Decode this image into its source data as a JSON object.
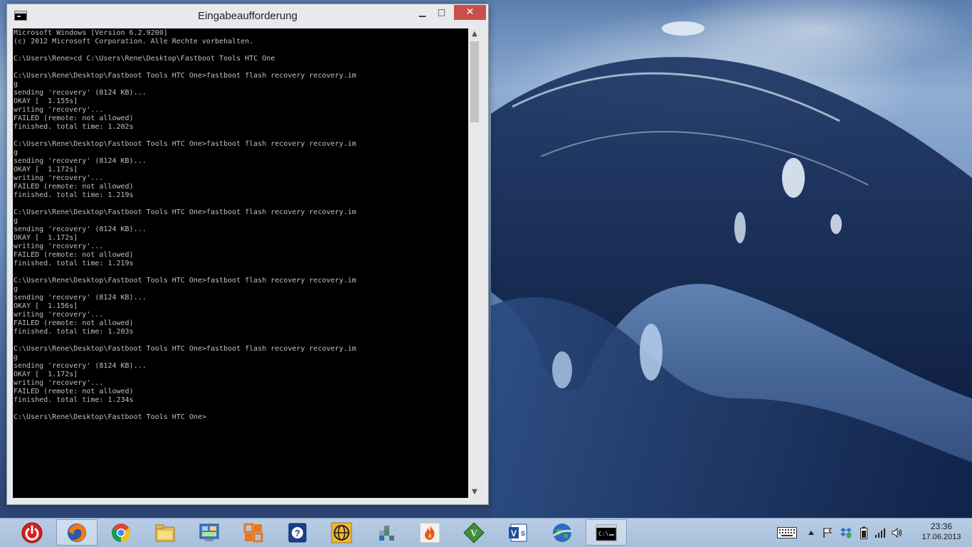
{
  "window": {
    "title": "Eingabeaufforderung",
    "minimize_glyph": "▁",
    "maximize_glyph": "□",
    "close_glyph": "✕",
    "console_lines": [
      "Microsoft Windows [Version 6.2.9200]",
      "(c) 2012 Microsoft Corporation. Alle Rechte vorbehalten.",
      "",
      "C:\\Users\\Rene>cd C:\\Users\\Rene\\Desktop\\Fastboot Tools HTC One",
      "",
      "C:\\Users\\Rene\\Desktop\\Fastboot Tools HTC One>fastboot flash recovery recovery.im",
      "g",
      "sending 'recovery' (8124 KB)...",
      "OKAY [  1.155s]",
      "writing 'recovery'...",
      "FAILED (remote: not allowed)",
      "finished. total time: 1.202s",
      "",
      "C:\\Users\\Rene\\Desktop\\Fastboot Tools HTC One>fastboot flash recovery recovery.im",
      "g",
      "sending 'recovery' (8124 KB)...",
      "OKAY [  1.172s]",
      "writing 'recovery'...",
      "FAILED (remote: not allowed)",
      "finished. total time: 1.219s",
      "",
      "C:\\Users\\Rene\\Desktop\\Fastboot Tools HTC One>fastboot flash recovery recovery.im",
      "g",
      "sending 'recovery' (8124 KB)...",
      "OKAY [  1.172s]",
      "writing 'recovery'...",
      "FAILED (remote: not allowed)",
      "finished. total time: 1.219s",
      "",
      "C:\\Users\\Rene\\Desktop\\Fastboot Tools HTC One>fastboot flash recovery recovery.im",
      "g",
      "sending 'recovery' (8124 KB)...",
      "OKAY [  1.156s]",
      "writing 'recovery'...",
      "FAILED (remote: not allowed)",
      "finished. total time: 1.203s",
      "",
      "C:\\Users\\Rene\\Desktop\\Fastboot Tools HTC One>fastboot flash recovery recovery.im",
      "g",
      "sending 'recovery' (8124 KB)...",
      "OKAY [  1.172s]",
      "writing 'recovery'...",
      "FAILED (remote: not allowed)",
      "finished. total time: 1.234s",
      "",
      "C:\\Users\\Rene\\Desktop\\Fastboot Tools HTC One>"
    ]
  },
  "taskbar": {
    "apps": [
      {
        "name": "power-icon",
        "active": false
      },
      {
        "name": "firefox-icon",
        "active": true
      },
      {
        "name": "chrome-icon",
        "active": false
      },
      {
        "name": "file-explorer-icon",
        "active": false
      },
      {
        "name": "control-panel-icon",
        "active": false
      },
      {
        "name": "office-icon",
        "active": false
      },
      {
        "name": "help-icon",
        "active": false
      },
      {
        "name": "globe-icon",
        "active": false
      },
      {
        "name": "metro-tiles-icon",
        "active": false
      },
      {
        "name": "flame-app-icon",
        "active": false
      },
      {
        "name": "vim-icon",
        "active": false
      },
      {
        "name": "visio-icon",
        "active": false
      },
      {
        "name": "google-earth-icon",
        "active": false
      },
      {
        "name": "command-prompt-icon",
        "active": true
      }
    ],
    "tray": {
      "icons": [
        "keyboard-icon",
        "show-hidden-icons-chevron",
        "action-center-flag-icon",
        "dropbox-icon",
        "battery-icon",
        "signal-icon",
        "volume-icon"
      ],
      "time": "23:36",
      "date": "17.06.2013"
    }
  },
  "colors": {
    "console_bg": "#000000",
    "console_text": "#c0c0c0",
    "close_button": "#c7504b",
    "taskbar": "#b0c6df"
  }
}
